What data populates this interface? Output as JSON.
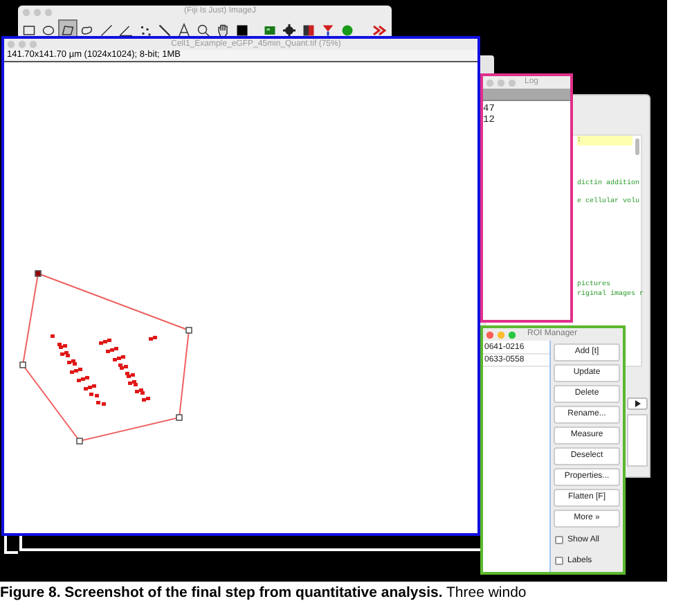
{
  "imagej": {
    "title": "(Fiji Is Just) ImageJ",
    "tools": [
      {
        "kind": "rect",
        "selected": false
      },
      {
        "kind": "oval",
        "selected": false
      },
      {
        "kind": "polygon",
        "selected": true
      },
      {
        "kind": "freehand",
        "selected": false
      },
      {
        "kind": "line",
        "selected": false
      },
      {
        "kind": "angle",
        "selected": false
      },
      {
        "kind": "point",
        "selected": false
      },
      {
        "kind": "wand",
        "selected": false
      },
      {
        "kind": "text",
        "selected": false
      },
      {
        "kind": "zoom",
        "selected": false
      },
      {
        "kind": "hand",
        "selected": false
      },
      {
        "kind": "color",
        "selected": false
      },
      {
        "kind": "image",
        "selected": false
      },
      {
        "kind": "gear",
        "selected": false
      },
      {
        "kind": "lut",
        "selected": false
      },
      {
        "kind": "pin",
        "selected": false
      },
      {
        "kind": "dot",
        "selected": false
      }
    ]
  },
  "image_window": {
    "title": "Cell1_Example_eGFP_45min_Quant.tif (75%)",
    "info": "141.70x141.70 µm (1024x1024); 8-bit; 1MB"
  },
  "script_editor": {
    "lines": [
      ":",
      "dictin addition",
      "e cellular volu",
      "pictures",
      "riginal images r"
    ]
  },
  "log": {
    "title": "Log",
    "lines": [
      "47",
      "12"
    ]
  },
  "roi_manager": {
    "title": "ROI Manager",
    "rois": [
      {
        "label": "0641-0216",
        "selected": false
      },
      {
        "label": "0633-0558",
        "selected": false
      }
    ],
    "buttons": [
      "Add [t]",
      "Update",
      "Delete",
      "Rename...",
      "Measure",
      "Deselect",
      "Properties...",
      "Flatten [F]",
      "More »"
    ],
    "checkboxes": [
      {
        "label": "Show All",
        "checked": false
      },
      {
        "label": "Labels",
        "checked": false
      }
    ]
  },
  "caption": "**Figure 8. Screenshot of the final step from quantitative analysis.** Three windo"
}
